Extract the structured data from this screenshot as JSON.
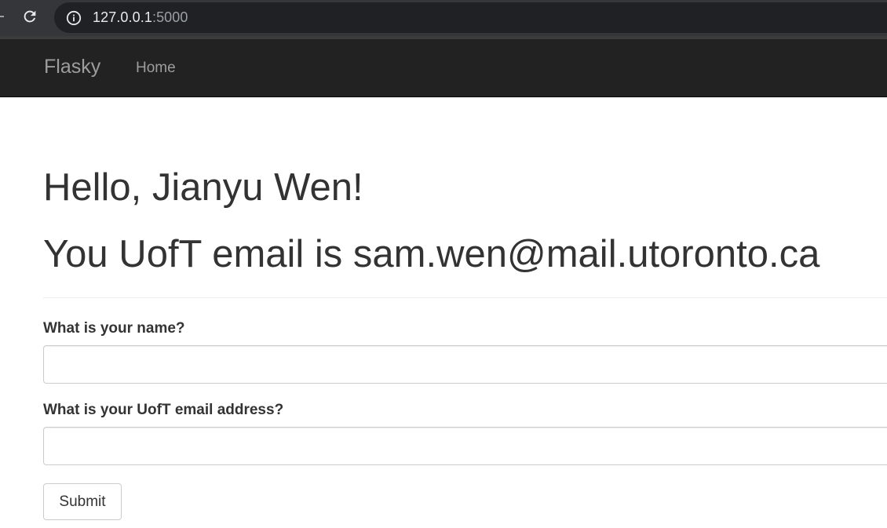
{
  "browser": {
    "url_host": "127.0.0.1",
    "url_port": ":5000",
    "icons": {
      "reload": "reload-icon",
      "info": "info-icon"
    }
  },
  "navbar": {
    "brand": "Flasky",
    "links": [
      {
        "label": "Home"
      }
    ],
    "background": "#222222",
    "link_color": "#9d9d9d"
  },
  "page": {
    "greeting": "Hello, Jianyu Wen!",
    "email_message": "You UofT email is sam.wen@mail.utoronto.ca"
  },
  "form": {
    "name_label": "What is your name?",
    "name_value": "",
    "email_label": "What is your UofT email address?",
    "email_value": "",
    "submit_label": "Submit"
  }
}
